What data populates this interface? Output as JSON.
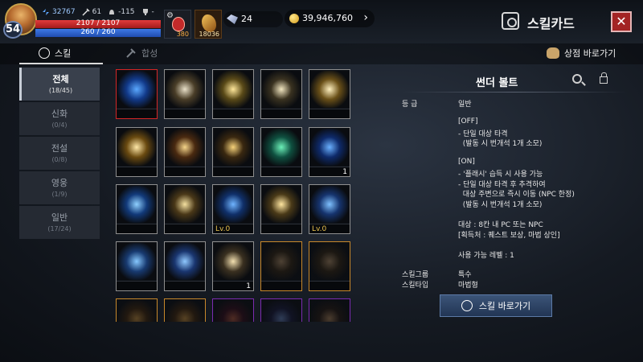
{
  "player": {
    "level": "54",
    "stat1": "32767",
    "stat2": "61",
    "stat3": "-115",
    "stat4": "-",
    "hp_text": "2107 / 2107",
    "mp_text": "260 / 260",
    "hp_fill": 1.0,
    "mp_fill": 1.0
  },
  "quick": {
    "potion_count": "380",
    "scroll_count": "18036"
  },
  "currency": {
    "gems": "24",
    "gold": "39,946,760"
  },
  "window": {
    "title": "스킬카드",
    "close": "✕"
  },
  "tabs": {
    "skill": "스킬",
    "combine": "합성",
    "shop": "상점 바로가기"
  },
  "categories": [
    {
      "name": "전체",
      "count": "(18/45)"
    },
    {
      "name": "신화",
      "count": "(0/4)"
    },
    {
      "name": "전설",
      "count": "(0/8)"
    },
    {
      "name": "영웅",
      "count": "(1/9)"
    },
    {
      "name": "일반",
      "count": "(17/24)"
    }
  ],
  "cards": [
    {
      "lv": "",
      "qty": ""
    },
    {
      "lv": "",
      "qty": ""
    },
    {
      "lv": "",
      "qty": ""
    },
    {
      "lv": "",
      "qty": ""
    },
    {
      "lv": "",
      "qty": ""
    },
    {
      "lv": "",
      "qty": ""
    },
    {
      "lv": "",
      "qty": ""
    },
    {
      "lv": "",
      "qty": ""
    },
    {
      "lv": "",
      "qty": ""
    },
    {
      "lv": "",
      "qty": "1"
    },
    {
      "lv": "",
      "qty": ""
    },
    {
      "lv": "",
      "qty": ""
    },
    {
      "lv": "Lv.0",
      "qty": ""
    },
    {
      "lv": "",
      "qty": ""
    },
    {
      "lv": "Lv.0",
      "qty": ""
    },
    {
      "lv": "",
      "qty": ""
    },
    {
      "lv": "",
      "qty": ""
    },
    {
      "lv": "",
      "qty": "1"
    },
    {
      "lv": "",
      "qty": ""
    },
    {
      "lv": "",
      "qty": ""
    },
    {
      "lv": "",
      "qty": ""
    },
    {
      "lv": "",
      "qty": ""
    },
    {
      "lv": "",
      "qty": ""
    },
    {
      "lv": "",
      "qty": ""
    },
    {
      "lv": "",
      "qty": ""
    }
  ],
  "detail": {
    "name": "썬더 볼트",
    "grade_label": "등 급",
    "grade_value": "일반",
    "desc_lines": [
      "[OFF]",
      "- 단일 대상 타격",
      "  (발동 시 번개석 1개 소모)",
      "",
      "[ON]",
      "- '플래시' 습득 시 사용 가능",
      "- 단일 대상 타격 후 추격하여",
      "  대상 주변으로 즉시 이동 (NPC 한정)",
      "  (발동 시 번개석 1개 소모)",
      "",
      "대상 : 8칸 내 PC 또는 NPC",
      "[획득처 : 퀘스트 보상, 마법 상인]",
      "",
      "사용 가능 레벨 : 1"
    ],
    "group_label": "스킬그룹",
    "group_value": "특수",
    "type_label": "스킬타입",
    "type_value": "마법형",
    "goto_button": "스킬 바로가기"
  }
}
